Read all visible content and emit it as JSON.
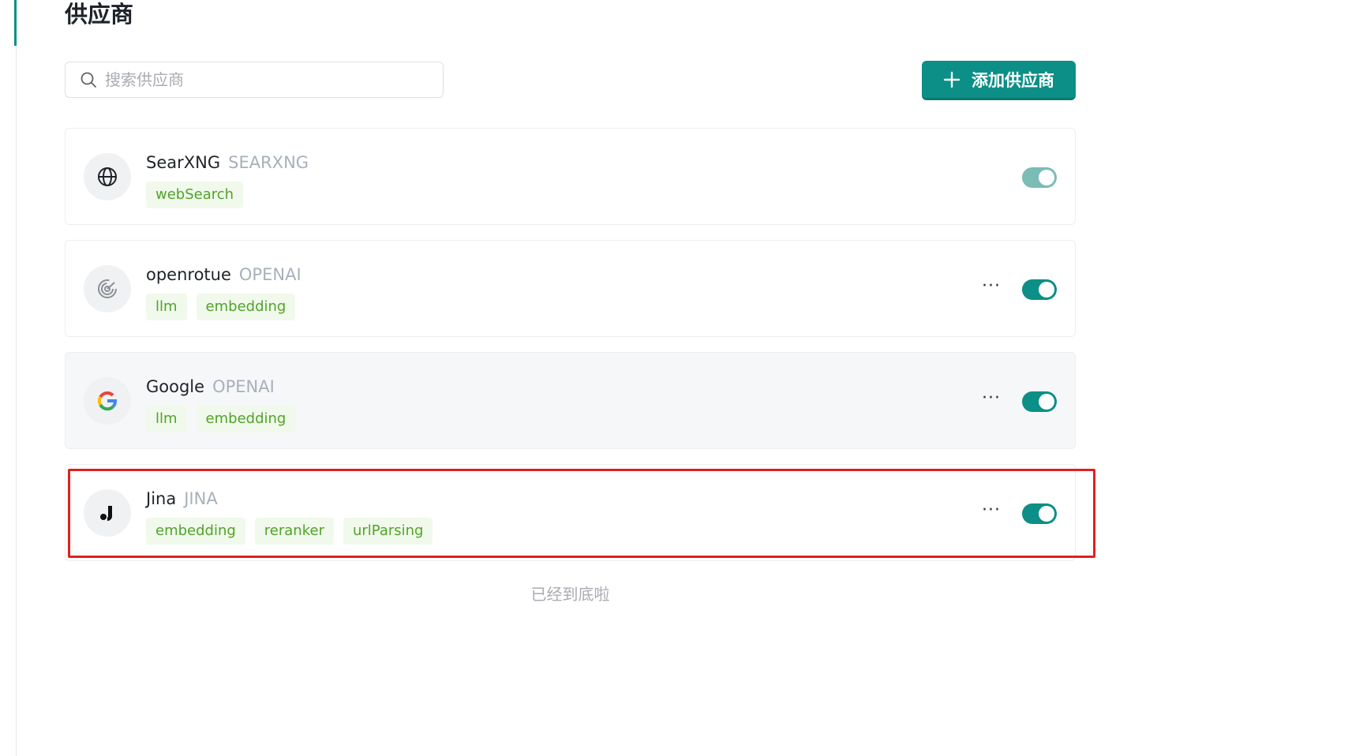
{
  "page": {
    "title": "供应商"
  },
  "search": {
    "placeholder": "搜索供应商",
    "value": ""
  },
  "toolbar": {
    "add_label": "添加供应商"
  },
  "providers": [
    {
      "name": "SearXNG",
      "type": "SEARXNG",
      "tags": [
        "webSearch"
      ],
      "icon": "globe-icon",
      "enabled": true,
      "has_menu": false
    },
    {
      "name": "openrotue",
      "type": "OPENAI",
      "tags": [
        "llm",
        "embedding"
      ],
      "icon": "radar-icon",
      "enabled": true,
      "has_menu": true,
      "menu_label": "···"
    },
    {
      "name": "Google",
      "type": "OPENAI",
      "tags": [
        "llm",
        "embedding"
      ],
      "icon": "google-logo-icon",
      "enabled": true,
      "has_menu": true,
      "menu_label": "···"
    },
    {
      "name": "Jina",
      "type": "JINA",
      "tags": [
        "embedding",
        "reranker",
        "urlParsing"
      ],
      "icon": "jina-logo-icon",
      "enabled": true,
      "has_menu": true,
      "menu_label": "···"
    }
  ],
  "footer": {
    "end_text": "已经到底啦"
  },
  "colors": {
    "accent": "#0b8f86",
    "tag_bg": "#f0f9eb",
    "tag_text": "#52a32b",
    "highlight": "#e02020"
  }
}
